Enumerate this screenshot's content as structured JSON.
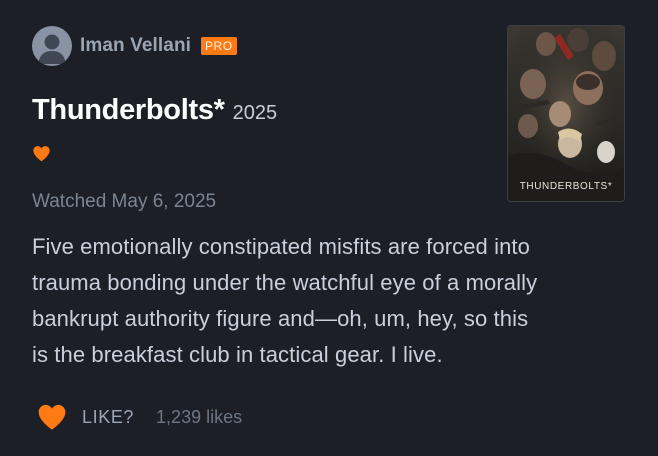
{
  "author": {
    "name": "Iman Vellani",
    "badge": "PRO",
    "avatar_icon": "user-silhouette-icon"
  },
  "film": {
    "title": "Thunderbolts*",
    "year": "2025",
    "poster_title": "THUNDERBOLTS*"
  },
  "liked_icon": "heart-icon",
  "watched_text": "Watched May 6, 2025",
  "review": {
    "lines": [
      "Five emotionally constipated misfits are forced into",
      "trauma bonding under the watchful eye of a morally",
      "bankrupt authority figure and—oh, um, hey, so this",
      "is the breakfast club in tactical gear. I live."
    ]
  },
  "actions": {
    "like_label": "LIKE?",
    "likes_count": "1,239 likes"
  },
  "colors": {
    "background": "#1c1f26",
    "accent_orange": "#ff7a12",
    "title_white": "#ffffff",
    "body_text": "#c9d0db",
    "muted_text": "#7a8492"
  }
}
